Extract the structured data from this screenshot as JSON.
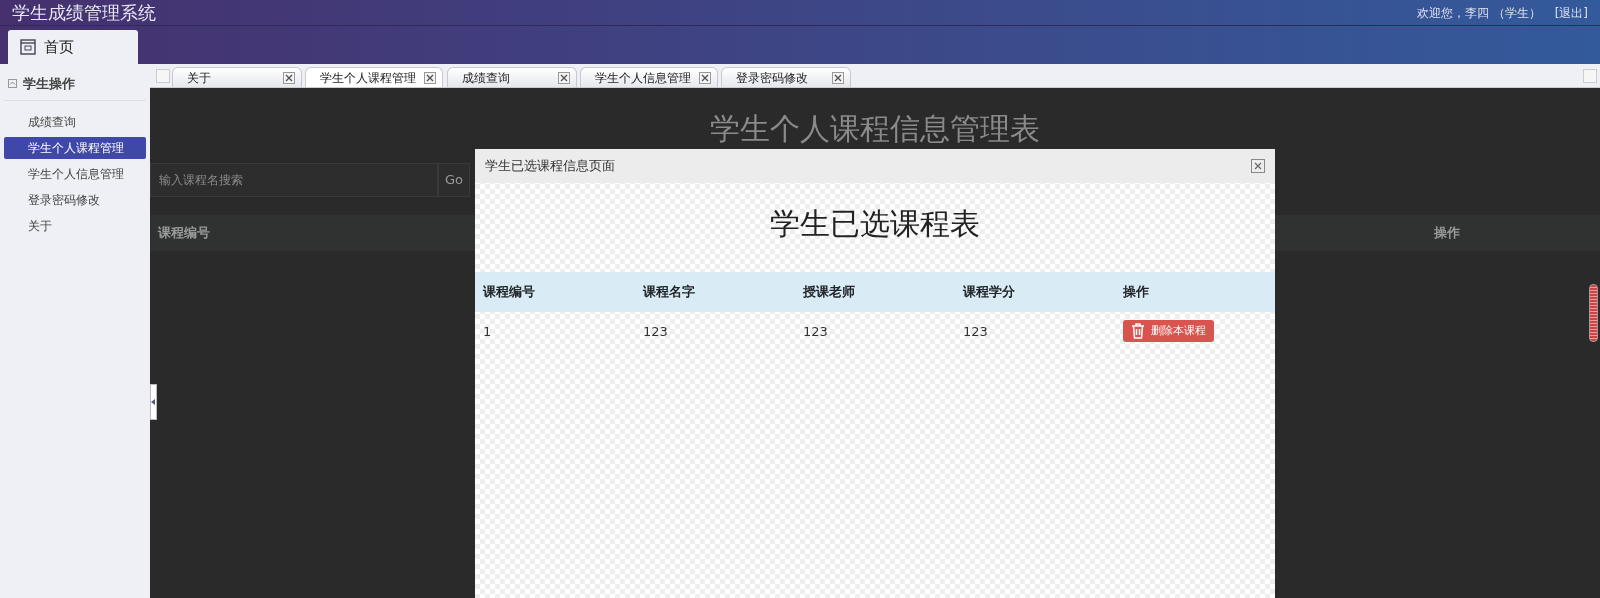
{
  "header": {
    "title": "学生成绩管理系统",
    "welcome": "欢迎您，李四 （学生）",
    "logout": "[退出]"
  },
  "home_tab": {
    "label": "首页"
  },
  "sidebar": {
    "section": "学生操作",
    "expanded": true,
    "items": [
      {
        "label": "成绩查询",
        "selected": false
      },
      {
        "label": "学生个人课程管理",
        "selected": true
      },
      {
        "label": "学生个人信息管理",
        "selected": false
      },
      {
        "label": "登录密码修改",
        "selected": false
      },
      {
        "label": "关于",
        "selected": false
      }
    ]
  },
  "tabs": [
    {
      "label": "关于",
      "selected": false
    },
    {
      "label": "学生个人课程管理",
      "selected": true
    },
    {
      "label": "成绩查询",
      "selected": false
    },
    {
      "label": "学生个人信息管理",
      "selected": false
    },
    {
      "label": "登录密码修改",
      "selected": false
    }
  ],
  "page": {
    "title": "学生个人课程信息管理表",
    "search": {
      "placeholder": "输入课程名搜索"
    },
    "search_button": "Go",
    "columns": [
      "课程编号",
      "操作"
    ]
  },
  "modal": {
    "title": "学生已选课程信息页面",
    "heading": "学生已选课程表",
    "columns": [
      "课程编号",
      "课程名字",
      "授课老师",
      "课程学分",
      "操作"
    ],
    "rows": [
      {
        "cells": [
          "1",
          "123",
          "123",
          "123"
        ],
        "action": "删除本课程"
      }
    ]
  }
}
